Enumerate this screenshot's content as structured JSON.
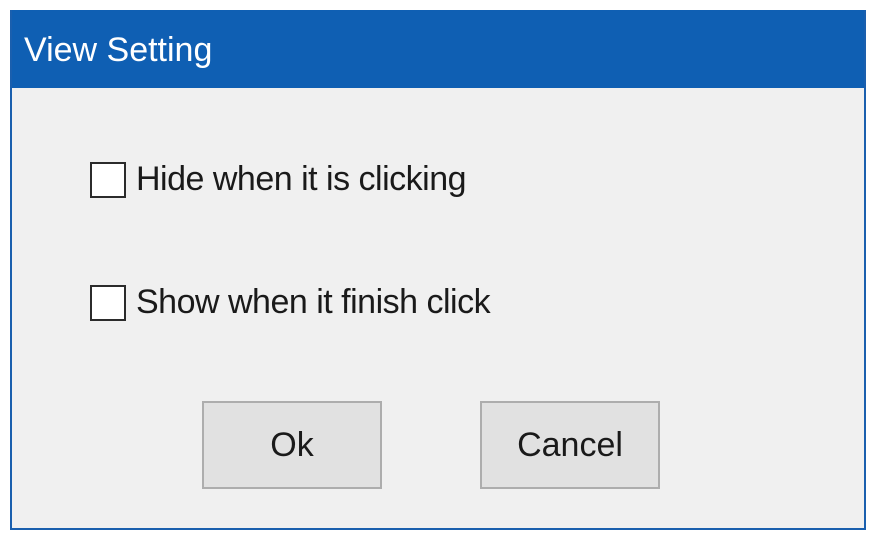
{
  "window": {
    "title": "View Setting"
  },
  "options": [
    {
      "label": "Hide when it is clicking",
      "checked": false
    },
    {
      "label": "Show when it finish click",
      "checked": false
    }
  ],
  "buttons": {
    "ok_label": "Ok",
    "cancel_label": "Cancel"
  },
  "colors": {
    "titlebar": "#0f5fb3",
    "dialog_background": "#f0f0f0",
    "button_background": "#e1e1e1"
  }
}
